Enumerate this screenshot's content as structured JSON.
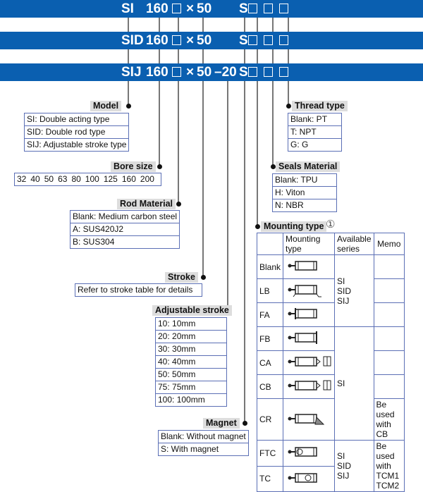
{
  "header": {
    "row1": {
      "series": "SI",
      "bore": "160",
      "x": "×",
      "stroke": "50",
      "adj": "",
      "s": "S"
    },
    "row2": {
      "series": "SID",
      "bore": "160",
      "x": "×",
      "stroke": "50",
      "adj": "",
      "s": "S"
    },
    "row3": {
      "series": "SIJ",
      "bore": "160",
      "x": "×",
      "stroke": "50",
      "adj": "–20",
      "s": "S"
    }
  },
  "colors": {
    "band": "#0a5fb0",
    "border": "#5b6fb5",
    "label_bg": "#dddddd"
  },
  "model": {
    "title": "Model",
    "items": [
      "SI: Double acting type",
      "SID: Double rod type",
      "SIJ: Adjustable stroke type"
    ]
  },
  "bore": {
    "title": "Bore size",
    "items": [
      "32",
      "40",
      "50",
      "63",
      "80",
      "100",
      "125",
      "160",
      "200"
    ]
  },
  "rod": {
    "title": "Rod Material",
    "items": [
      "Blank: Medium carbon steel",
      "A: SUS420J2",
      "B: SUS304"
    ]
  },
  "stroke": {
    "title": "Stroke",
    "items": [
      "Refer to stroke table for details"
    ]
  },
  "adjustable": {
    "title": "Adjustable stroke",
    "items": [
      "10: 10mm",
      "20: 20mm",
      "30: 30mm",
      "40: 40mm",
      "50: 50mm",
      "75: 75mm",
      "100: 100mm"
    ]
  },
  "magnet": {
    "title": "Magnet",
    "items": [
      "Blank: Without magnet",
      "S: With magnet"
    ]
  },
  "thread": {
    "title": "Thread type",
    "items": [
      "Blank: PT",
      "T: NPT",
      "G: G"
    ]
  },
  "seals": {
    "title": "Seals Material",
    "items": [
      "Blank: TPU",
      "H: Viton",
      "N: NBR"
    ]
  },
  "mounting": {
    "title": "Mounting type",
    "note": "①",
    "headers": [
      "",
      "Mounting type",
      "Available series",
      "Memo"
    ],
    "codes": [
      "Blank",
      "LB",
      "FA",
      "FB",
      "CA",
      "CB",
      "CR",
      "FTC",
      "TC"
    ],
    "series_groups": [
      [
        "SI",
        "SID",
        "SIJ"
      ],
      [
        "SI"
      ],
      [
        "SI",
        "SID",
        "SIJ"
      ]
    ],
    "memos": [
      "Be used with CB",
      "Be used with TCM1 TCM2"
    ]
  }
}
